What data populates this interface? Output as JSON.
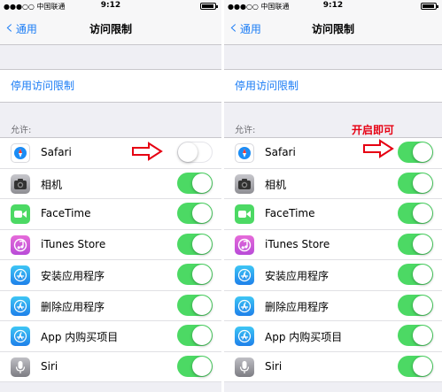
{
  "status_bar": {
    "carrier": "●●●○○ 中国联通",
    "time": "9:12"
  },
  "nav": {
    "back_label": "通用",
    "title": "访问限制"
  },
  "disable_label": "停用访问限制",
  "section_header": "允许:",
  "left_rows": [
    {
      "label": "Safari",
      "icon": "safari-icon",
      "enabled": false
    },
    {
      "label": "相机",
      "icon": "camera-icon",
      "enabled": true
    },
    {
      "label": "FaceTime",
      "icon": "facetime-icon",
      "enabled": true
    },
    {
      "label": "iTunes Store",
      "icon": "itunes-store-icon",
      "enabled": true
    },
    {
      "label": "安装应用程序",
      "icon": "app-store-icon",
      "enabled": true
    },
    {
      "label": "删除应用程序",
      "icon": "app-store-icon",
      "enabled": true
    },
    {
      "label": "App 内购买项目",
      "icon": "app-store-icon",
      "enabled": true
    },
    {
      "label": "Siri",
      "icon": "siri-icon",
      "enabled": true
    }
  ],
  "right_rows": [
    {
      "label": "Safari",
      "icon": "safari-icon",
      "enabled": true
    },
    {
      "label": "相机",
      "icon": "camera-icon",
      "enabled": true
    },
    {
      "label": "FaceTime",
      "icon": "facetime-icon",
      "enabled": true
    },
    {
      "label": "iTunes Store",
      "icon": "itunes-store-icon",
      "enabled": true
    },
    {
      "label": "安装应用程序",
      "icon": "app-store-icon",
      "enabled": true
    },
    {
      "label": "删除应用程序",
      "icon": "app-store-icon",
      "enabled": true
    },
    {
      "label": "App 内购买项目",
      "icon": "app-store-icon",
      "enabled": true
    },
    {
      "label": "Siri",
      "icon": "siri-icon",
      "enabled": true
    }
  ],
  "annotation": "开启即可",
  "colors": {
    "accent": "#1a7cf5",
    "toggle_on": "#4cd964",
    "annotation": "#e60012"
  }
}
